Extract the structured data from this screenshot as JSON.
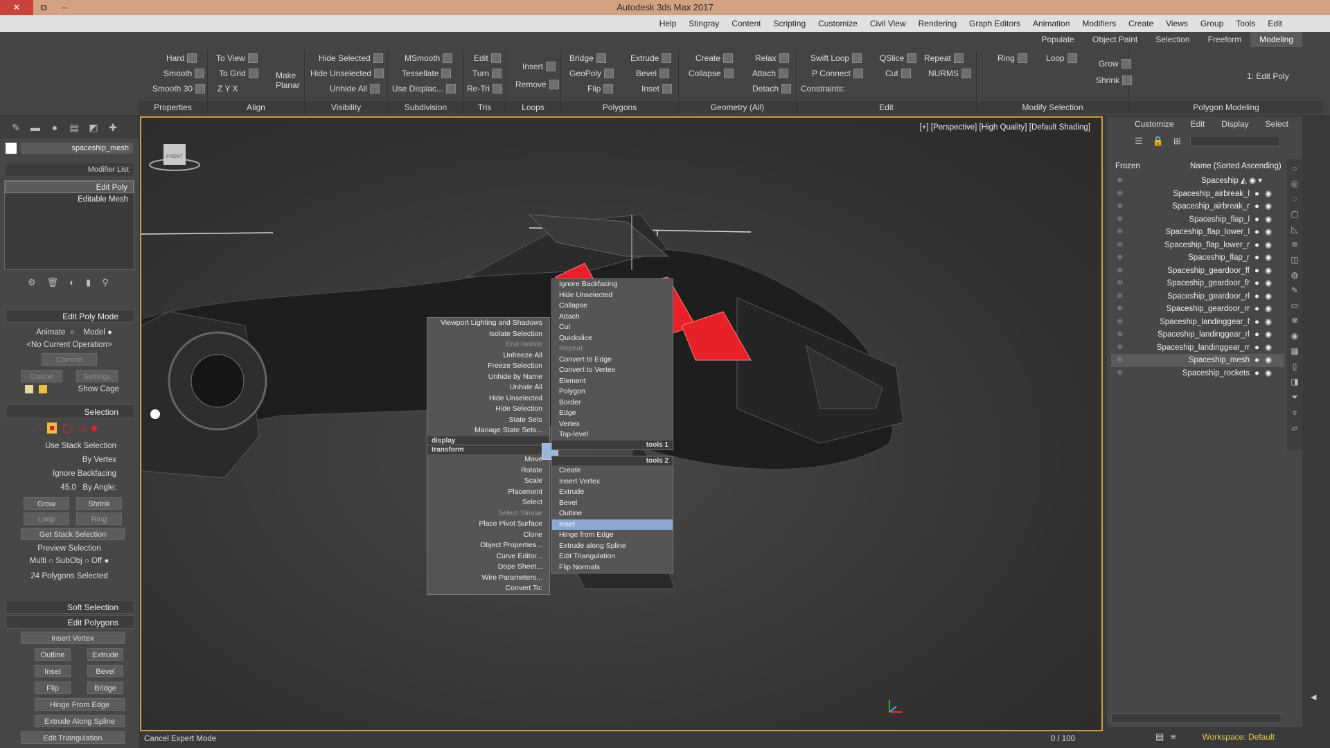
{
  "window": {
    "title": "Autodesk 3ds Max 2017",
    "close": "✕",
    "restore": "⧉",
    "minimize": "–"
  },
  "menu": [
    "Help",
    "Stingray",
    "Content",
    "Scripting",
    "Customize",
    "Civil View",
    "Rendering",
    "Graph Editors",
    "Animation",
    "Modifiers",
    "Create",
    "Views",
    "Group",
    "Tools",
    "Edit"
  ],
  "ribbon_tabs": [
    "Populate",
    "Object Paint",
    "Selection",
    "Freeform",
    "Modeling"
  ],
  "ribbon": {
    "groups": [
      "Properties",
      "Align",
      "Visibility",
      "Subdivision",
      "Tris",
      "Loops",
      "Polygons",
      "Geometry (All)",
      "Edit",
      "Modify Selection",
      "Polygon Modeling"
    ],
    "properties": [
      "Hard",
      "Smooth",
      "Smooth 30"
    ],
    "align": [
      "To View",
      "To Grid",
      "X",
      "Y",
      "Z",
      "Make Planar"
    ],
    "visibility": [
      "Hide Selected",
      "Hide Unselected",
      "Unhide All"
    ],
    "subdivision": [
      "MSmooth",
      "Tessellate",
      "Use Displac..."
    ],
    "tris": [
      "Edit",
      "Turn",
      "Re-Tri"
    ],
    "loops": [
      "Insert",
      "Remove"
    ],
    "polygons": [
      "Bridge",
      "GeoPoly",
      "Flip",
      "Extrude",
      "Bevel",
      "Inset"
    ],
    "geometry": [
      "Create",
      "Collapse",
      "Relax",
      "Attach",
      "Detach"
    ],
    "edit": [
      "Swift Loop",
      "P Connect",
      "Constraints:",
      "QSlice",
      "Cut",
      "NURMS",
      "Repeat"
    ],
    "modsel": [
      "Loop",
      "Ring",
      "Grow",
      "Shrink"
    ],
    "polymodel": [
      "1: Edit Poly"
    ]
  },
  "left": {
    "object_name": "spaceship_mesh",
    "modifier_list": "Modifier List",
    "modifiers": [
      "Edit Poly",
      "Editable Mesh"
    ],
    "edit_poly_mode": {
      "title": "Edit Poly Mode",
      "model": "Model",
      "animate": "Animate",
      "current_op": "<No Current Operation>",
      "commit": "Commit",
      "settings": "Settings",
      "cancel": "Cancel",
      "show_cage": "Show Cage"
    },
    "selection": {
      "title": "Selection",
      "use_stack": "Use Stack Selection",
      "by_vertex": "By Vertex",
      "ignore_backfacing": "Ignore Backfacing",
      "by_angle": "By Angle:",
      "angle_value": "45.0",
      "grow": "Grow",
      "shrink": "Shrink",
      "loop": "Loop",
      "ring": "Ring",
      "get_stack": "Get Stack Selection",
      "preview": "Preview Selection",
      "off": "Off",
      "subobj": "SubObj",
      "multi": "Multi",
      "status": "24 Polygons Selected"
    },
    "soft_selection": "Soft Selection",
    "edit_polygons": {
      "title": "Edit Polygons",
      "insert_vertex": "Insert Vertex",
      "outline": "Outline",
      "extrude": "Extrude",
      "inset": "Inset",
      "bevel": "Bevel",
      "flip": "Flip",
      "bridge": "Bridge",
      "hinge": "Hinge From Edge",
      "extrude_spline": "Extrude Along Spline",
      "edit_tri": "Edit Triangulation"
    }
  },
  "viewport": {
    "label": "[+] [Perspective] [High Quality] [Default Shading]",
    "viewcube": "FRONT"
  },
  "quad_menu": {
    "left_top": [
      "Viewport Lighting and Shadows",
      "Isolate Selection",
      "End Isolate",
      "Unfreeze All",
      "Freeze Selection",
      "Unhide by Name",
      "Unhide All",
      "Hide Unselected",
      "Hide Selection",
      "State Sets",
      "Manage State Sets..."
    ],
    "left_top_header": "display",
    "left_bottom_header": "transform",
    "left_bottom": [
      "Move",
      "Rotate",
      "Scale",
      "Placement",
      "Select",
      "Select Similar",
      "Place Pivot Surface",
      "Clone",
      "Object Properties...",
      "Curve Editor...",
      "Dope Sheet...",
      "Wire Parameters...",
      "Convert To:"
    ],
    "right_top": [
      "Ignore Backfacing",
      "Hide Unselected",
      "Collapse",
      "Attach",
      "Cut",
      "Quickslice",
      "Repeat",
      "Convert to Edge",
      "Convert to Vertex",
      "Element",
      "Polygon",
      "Border",
      "Edge",
      "Vertex",
      "Top-level"
    ],
    "right_top_header": "tools 1",
    "right_bottom_header": "tools 2",
    "right_bottom": [
      "Create",
      "Insert Vertex",
      "Extrude",
      "Bevel",
      "Outline",
      "Inset",
      "Hinge from Edge",
      "Extrude along Spline",
      "Edit Triangulation",
      "Flip Normals"
    ]
  },
  "scene_explorer": {
    "tabs": [
      "Select",
      "Display",
      "Edit",
      "Customize"
    ],
    "col_frozen": "Frozen",
    "col_name": "Name (Sorted Ascending)",
    "root": "Spaceship",
    "items": [
      "Spaceship_airbreak_l",
      "Spaceship_airbreak_r",
      "Spaceship_flap_l",
      "Spaceship_flap_lower_l",
      "Spaceship_flap_lower_r",
      "Spaceship_flap_r",
      "Spaceship_geardoor_ff",
      "Spaceship_geardoor_fr",
      "Spaceship_geardoor_rl",
      "Spaceship_geardoor_rr",
      "Spaceship_landinggear_f",
      "Spaceship_landinggear_rl",
      "Spaceship_landinggear_rr",
      "Spaceship_mesh",
      "Spaceship_rockets"
    ],
    "selected_index": 13
  },
  "status": {
    "left": "Cancel Expert Mode",
    "frame": "0 / 100",
    "workspace": "Workspace: Default"
  },
  "colors": {
    "selection_red": "#e8202a",
    "viewport_border": "#c8a040",
    "title_bar": "#d2a383"
  }
}
